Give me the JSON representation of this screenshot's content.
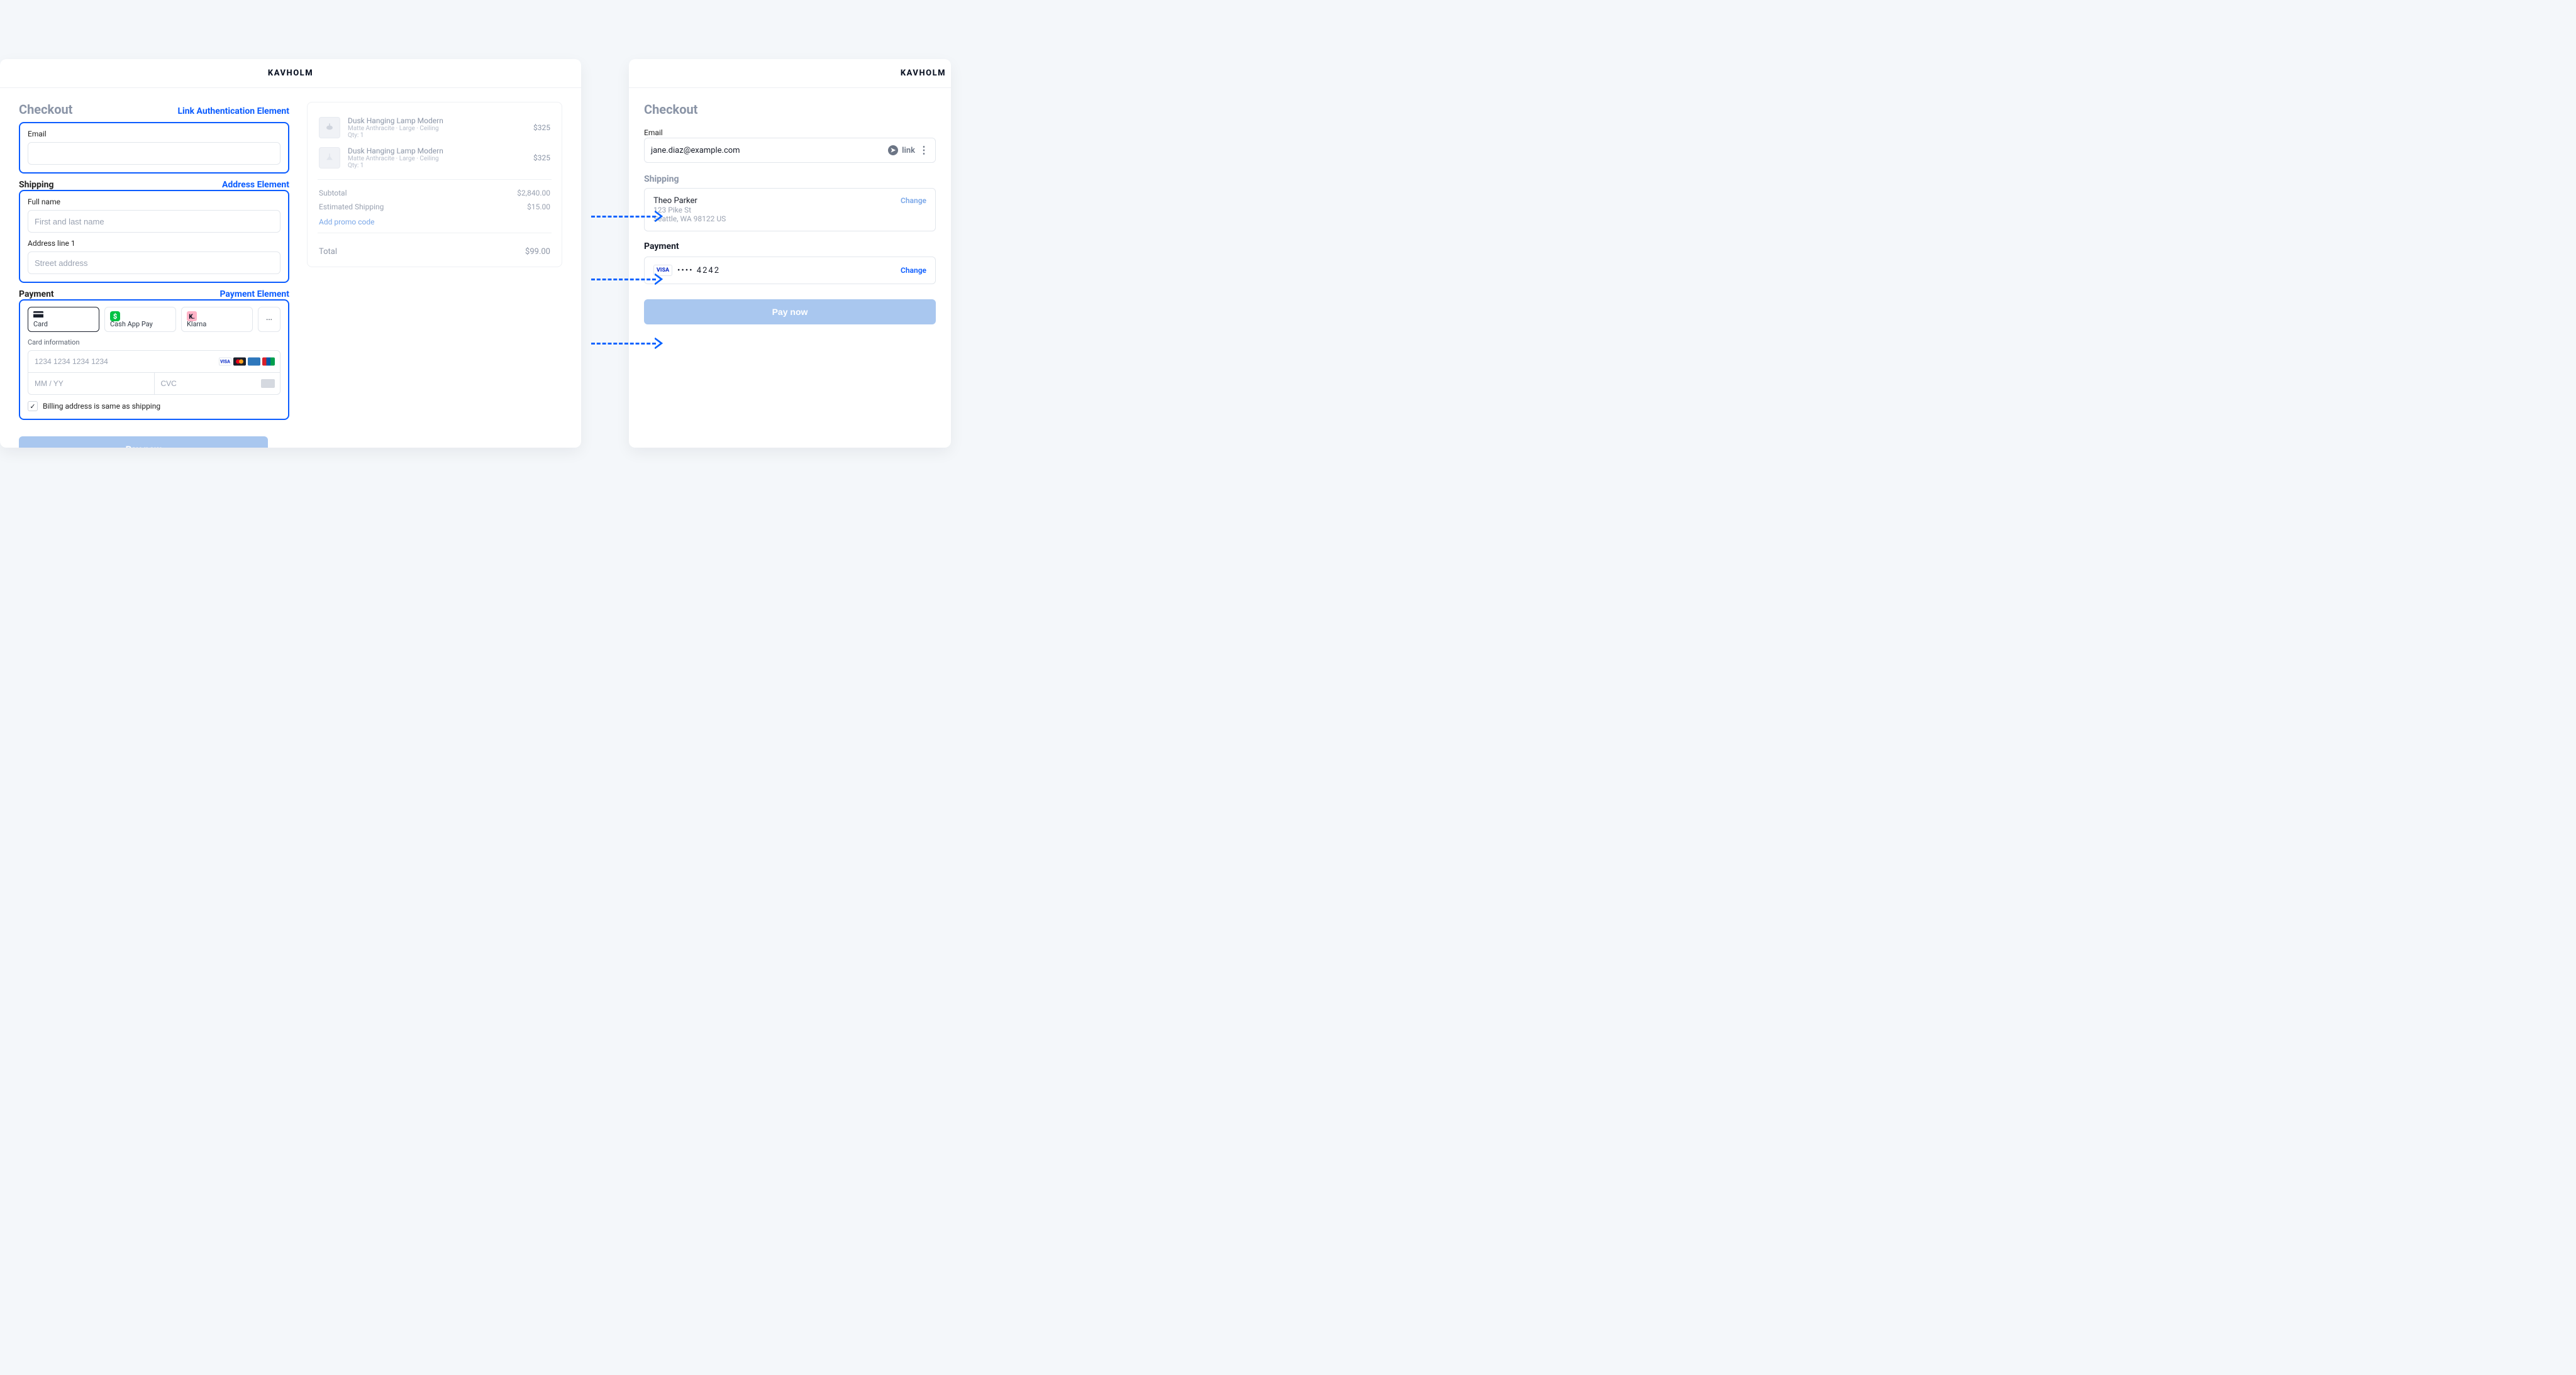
{
  "brand": "KAVHOLM",
  "checkout_title": "Checkout",
  "labels": {
    "link_auth": "Link Authentication Element",
    "address": "Address Element",
    "payment": "Payment Element"
  },
  "email": {
    "label": "Email"
  },
  "shipping": {
    "title": "Shipping",
    "full_name_label": "Full name",
    "full_name_placeholder": "First and last name",
    "addr1_label": "Address line 1",
    "addr1_placeholder": "Street address"
  },
  "payment": {
    "title": "Payment",
    "tabs": {
      "card": "Card",
      "cashapp": "Cash App Pay",
      "klarna": "Klarna",
      "more": "···"
    },
    "card_info_label": "Card information",
    "card_number_ph": "1234 1234 1234 1234",
    "exp_ph": "MM / YY",
    "cvc_ph": "CVC",
    "billing_same_label": "Billing address is same as shipping",
    "pay_now": "Pay now"
  },
  "cart": {
    "items": [
      {
        "name": "Dusk Hanging Lamp Modern",
        "sub": "Matte Anthracite · Large · Ceiling",
        "qty": "Qty: 1",
        "price": "$325"
      },
      {
        "name": "Dusk Hanging Lamp Modern",
        "sub": "Matte Anthracite · Large · Ceiling",
        "qty": "Qty: 1",
        "price": "$325"
      }
    ],
    "subtotal_label": "Subtotal",
    "subtotal_value": "$2,840.00",
    "ship_label": "Estimated Shipping",
    "ship_value": "$15.00",
    "promo": "Add promo code",
    "total_label": "Total",
    "total_value": "$99.00"
  },
  "right": {
    "email_label": "Email",
    "email_value": "jane.diaz@example.com",
    "link_text": "link",
    "shipping_title": "Shipping",
    "ship_name": "Theo Parker",
    "ship_line1": "123 Pike St",
    "ship_line2": "Seattle, WA 98122 US",
    "change": "Change",
    "payment_title": "Payment",
    "card_mask": "•••• 4242",
    "pay_now": "Pay now"
  },
  "colors": {
    "accent": "#0b5cff",
    "arrow": "#0b63ff",
    "cashapp": "#00c244",
    "klarna": "#ffb3c7",
    "visa": "#1434cb",
    "mc1": "#eb001b",
    "mc2": "#f79e1b",
    "amex": "#2e77bc",
    "unionpay": "#d81f2a"
  }
}
